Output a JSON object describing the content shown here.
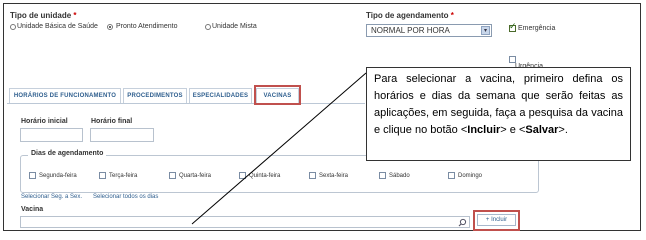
{
  "unit_type": {
    "label": "Tipo de unidade",
    "required_mark": "*",
    "options": [
      {
        "label": "Unidade Básica de Saúde",
        "checked": false
      },
      {
        "label": "Pronto Atendimento",
        "checked": true
      },
      {
        "label": "Unidade Mista",
        "checked": false
      }
    ]
  },
  "scheduling_type": {
    "label": "Tipo de agendamento",
    "required_mark": "*",
    "selected": "NORMAL POR HORA"
  },
  "flags": {
    "emergency": {
      "label": "Emergência",
      "checked": true
    },
    "urgency": {
      "label": "Urgência",
      "checked": false
    }
  },
  "tabs": [
    {
      "label": "HORÁRIOS DE FUNCIONAMENTO",
      "active": false
    },
    {
      "label": "PROCEDIMENTOS",
      "active": false
    },
    {
      "label": "ESPECIALIDADES",
      "active": false
    },
    {
      "label": "VACINAS",
      "active": true
    }
  ],
  "hours": {
    "start_label": "Horário inicial",
    "end_label": "Horário final",
    "start_value": "",
    "end_value": ""
  },
  "schedule_days": {
    "legend": "Dias de agendamento",
    "days": [
      {
        "label": "Segunda-feira",
        "checked": false
      },
      {
        "label": "Terça-feira",
        "checked": false
      },
      {
        "label": "Quarta-feira",
        "checked": false
      },
      {
        "label": "Quinta-feira",
        "checked": false
      },
      {
        "label": "Sexta-feira",
        "checked": false
      },
      {
        "label": "Sábado",
        "checked": false
      },
      {
        "label": "Domingo",
        "checked": false
      }
    ],
    "select_weekdays_link": "Selecionar Seg. a Sex.",
    "select_all_link": "Selecionar todos os dias"
  },
  "vaccine": {
    "label": "Vacina",
    "value": "",
    "include_button": "+ Incluir"
  },
  "callout": {
    "text_1": "Para selecionar a vacina, primeiro defina os horários e dias da semana que serão feitas as aplicações, em seguida, faça a pesquisa da vacina e clique no botão <",
    "bold_1": "Incluir",
    "text_2": "> e <",
    "bold_2": "Salvar",
    "text_3": ">."
  },
  "colors": {
    "highlight": "#c0504d",
    "link": "#2e5e8e",
    "required": "#cc0000"
  },
  "icons": {
    "search": "magnifier",
    "dropdown": "chevron-down",
    "check": "checkmark"
  }
}
